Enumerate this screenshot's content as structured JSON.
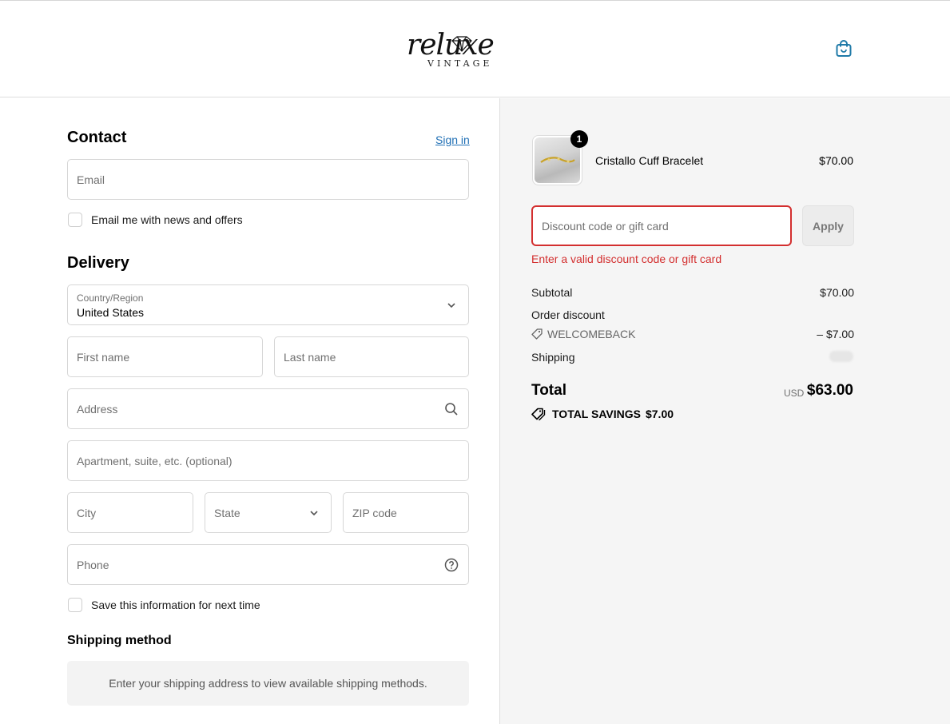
{
  "header": {
    "logo_script": "reluxe",
    "logo_sub": "VINTAGE",
    "bag_icon": "shopping-bag-icon"
  },
  "contact": {
    "title": "Contact",
    "sign_in": "Sign in",
    "email_placeholder": "Email",
    "email_opt_in": "Email me with news and offers"
  },
  "delivery": {
    "title": "Delivery",
    "country_label": "Country/Region",
    "country_value": "United States",
    "first_name_placeholder": "First name",
    "last_name_placeholder": "Last name",
    "address_placeholder": "Address",
    "apartment_placeholder": "Apartment, suite, etc. (optional)",
    "city_placeholder": "City",
    "state_placeholder": "State",
    "zip_placeholder": "ZIP code",
    "phone_placeholder": "Phone",
    "save_info": "Save this information for next time"
  },
  "shipping_method": {
    "title": "Shipping method",
    "message": "Enter your shipping address to view available shipping methods."
  },
  "order": {
    "item": {
      "quantity": "1",
      "name": "Cristallo Cuff Bracelet",
      "price": "$70.00"
    },
    "discount_placeholder": "Discount code or gift card",
    "apply_label": "Apply",
    "error": "Enter a valid discount code or gift card",
    "subtotal_label": "Subtotal",
    "subtotal_value": "$70.00",
    "order_discount_label": "Order discount",
    "discount_code": "WELCOMEBACK",
    "discount_value": "– $7.00",
    "shipping_label": "Shipping",
    "total_label": "Total",
    "currency": "USD",
    "total_value": "$63.00",
    "savings_label": "TOTAL SAVINGS",
    "savings_value": "$7.00"
  },
  "colors": {
    "error": "#d32f2f",
    "link": "#1f6fb5",
    "icon_accent": "#1f7aa8"
  }
}
